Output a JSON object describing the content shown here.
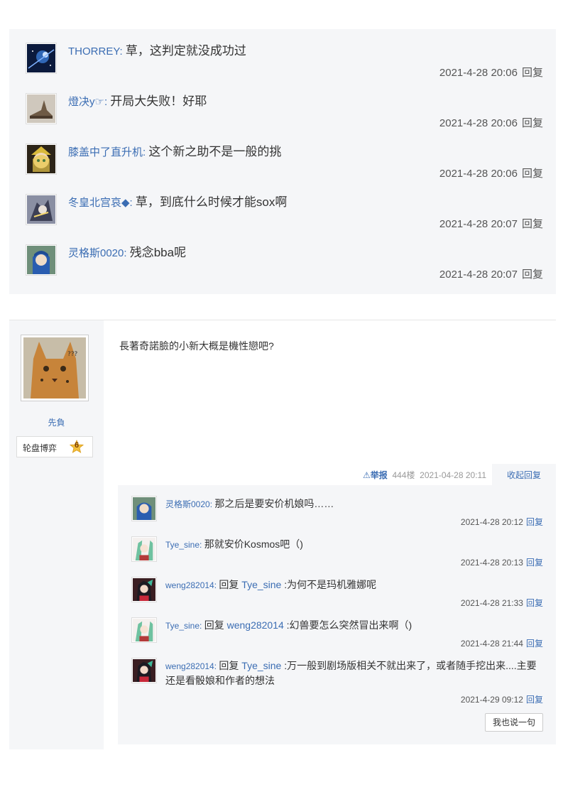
{
  "top_replies": [
    {
      "user": "THORREY",
      "text": "草，这判定就没成功过",
      "time": "2021-4-28 20:06",
      "reply": "回复"
    },
    {
      "user": "燈决y☞",
      "text": "开局大失败！好耶",
      "time": "2021-4-28 20:06",
      "reply": "回复"
    },
    {
      "user": "膝盖中了直升机",
      "text": "这个新之助不是一般的挑",
      "time": "2021-4-28 20:06",
      "reply": "回复"
    },
    {
      "user": "冬皇北宫哀◆",
      "text": "草，到底什么时候才能sox啊",
      "time": "2021-4-28 20:07",
      "reply": "回复"
    },
    {
      "user": "灵格斯0020",
      "text": "残念bba呢",
      "time": "2021-4-28 20:07",
      "reply": "回复"
    }
  ],
  "post": {
    "author": {
      "name": "先負",
      "avatar_text": "???",
      "badge_name": "轮盘博弈",
      "badge_level": "6"
    },
    "content": "長著奇諾臉的小新大概是機性戀吧?",
    "footer": {
      "report": "举报",
      "floor": "444楼",
      "time": "2021-04-28 20:11",
      "collapse": "收起回复"
    },
    "replies": [
      {
        "user": "灵格斯0020",
        "prefix": "",
        "target": "",
        "text": "那之后是要安价机娘吗……",
        "time": "2021-4-28 20:12",
        "reply": "回复"
      },
      {
        "user": "Tye_sine",
        "prefix": "",
        "target": "",
        "text": "那就安价Kosmos吧（)",
        "time": "2021-4-28 20:13",
        "reply": "回复"
      },
      {
        "user": "weng282014",
        "prefix": "回复 ",
        "target": "Tye_sine",
        "text": " :为何不是玛机雅娜呢",
        "time": "2021-4-28 21:33",
        "reply": "回复"
      },
      {
        "user": "Tye_sine",
        "prefix": "回复 ",
        "target": "weng282014",
        "text": " :幻兽要怎么突然冒出来啊（)",
        "time": "2021-4-28 21:44",
        "reply": "回复"
      },
      {
        "user": "weng282014",
        "prefix": "回复 ",
        "target": "Tye_sine",
        "text": " :万一般到剧场版相关不就出来了，或者随手挖出来....主要还是看骰娘和作者的想法",
        "time": "2021-4-29 09:12",
        "reply": "回复"
      }
    ],
    "say_button": "我也说一句"
  }
}
